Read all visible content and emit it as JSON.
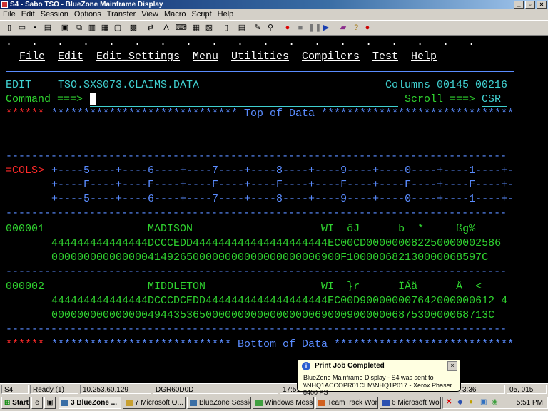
{
  "window": {
    "title": "S4 - Sabo TSO - BlueZone Mainframe Display"
  },
  "menubar": [
    "File",
    "Edit",
    "Session",
    "Options",
    "Transfer",
    "View",
    "Macro",
    "Script",
    "Help"
  ],
  "toolbar_icons": [
    "new-icon",
    "open-icon",
    "save-icon",
    "print-icon",
    "copy-icon",
    "paste-icon",
    "record-icon",
    "stop-icon",
    "pause-icon",
    "play-icon",
    "help-icon"
  ],
  "terminal": {
    "dots": ".   .   .   .   .   .   .   .   .   .   .   .   .   .   .   .   .   .   .",
    "menu": [
      "File",
      "Edit",
      "Edit_Settings",
      "Menu",
      "Utilities",
      "Compilers",
      "Test",
      "Help"
    ],
    "edit_label": "EDIT",
    "dataset": "TSO.SXS073.CLAIMS.DATA",
    "columns": "Columns 00145 00216",
    "command_label": "Command ===>",
    "scroll_label": "Scroll ===>",
    "scroll_value": "CSR",
    "top_prefix": "******",
    "top_line": "***************************** Top of Data ******************************",
    "dash_line": "-------------------------------------------------------------------------------------------",
    "cols_label": "=COLS>",
    "cols_line1": "+----5----+----6----+----7----+----8----+----9----+----0----+----1----+-",
    "cols_line2": "+----F----+----F----+----F----+----F----+----F----+----F----+----F----+-",
    "cols_line3": "+----5----+----6----+----7----+----8----+----9----+----0----+----1----+-",
    "records": [
      {
        "num": "000001",
        "text": "               MADISON                    WI  ôJ      b  *     ßg%",
        "hex1": "444444444444444DCCCEDD444444444444444444444EC00CD000000082250000002586",
        "hex2": "000000000000000414926500000000000000000006900F100000682130000068597C"
      },
      {
        "num": "000002",
        "text": "               MIDDLETON                  WI  }r      ÏÁä      Å  <",
        "hex1": "444444444444444DCCCDCEDD4444444444444444444EC00D900000007642000000612 4",
        "hex2": "00000000000000049443536500000000000000000690009000000687530000068713C"
      }
    ],
    "bottom_prefix": "******",
    "bottom_line": "**************************** Bottom of Data ****************************"
  },
  "statusbar": {
    "session": "S4",
    "ready": "Ready (1)",
    "ip": "10.253.60.129",
    "device": "DGR60D0D",
    "time": "17:51",
    "clock2": "3:36",
    "position": "05, 015"
  },
  "balloon": {
    "title": "Print Job Completed",
    "line1": "BlueZone Mainframe Display  -  S4 was sent to",
    "line2": "\\\\NHQ1ACCOPR01CLM\\NHQ1P017 - Xerox Phaser 8400 PS"
  },
  "taskbar": {
    "start": "Start",
    "tasks": [
      "3 BlueZone ...",
      "7 Microsoft O...",
      "BlueZone Sessio...",
      "Windows Messe...",
      "TeamTrack Wor...",
      "6 Microsoft Word"
    ],
    "clock": "5:51 PM"
  }
}
